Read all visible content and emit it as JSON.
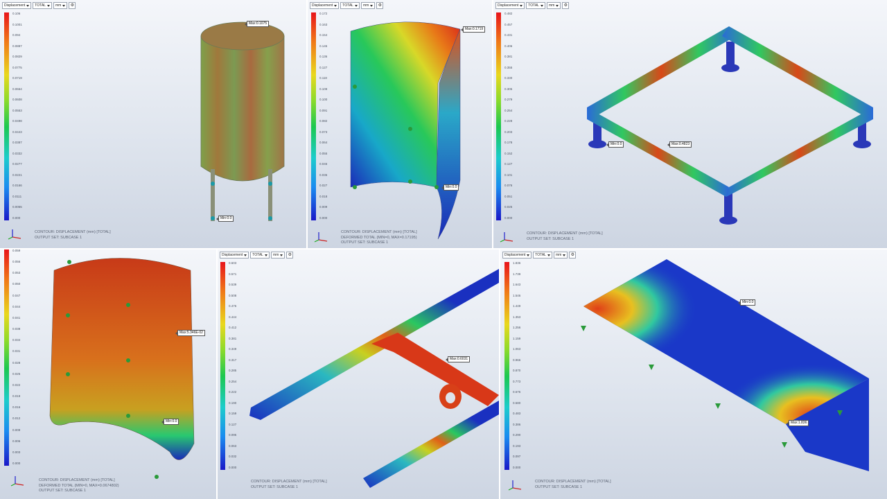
{
  "toolbar": {
    "result_label": "Displacement",
    "component_label": "TOTAL",
    "unit_label": "mm"
  },
  "panels": [
    {
      "ticks": [
        "0.106",
        "0.1001",
        "0.094",
        "0.0887",
        "0.0829",
        "0.0775",
        "0.0719",
        "0.0664",
        "0.0608",
        "0.0553",
        "0.0498",
        "0.0443",
        "0.0387",
        "0.0332",
        "0.0277",
        "0.0221",
        "0.0166",
        "0.0111",
        "0.0055",
        "0.000"
      ],
      "info": [
        "CONTOUR: DISPLACEMENT (mm) [TOTAL]",
        "OUTPUT SET: SUBCASE 1"
      ],
      "tags": [
        "Max:0.1075",
        "Min:0.0"
      ]
    },
    {
      "ticks": [
        "0.172",
        "0.163",
        "0.154",
        "0.145",
        "0.136",
        "0.127",
        "0.118",
        "0.109",
        "0.100",
        "0.091",
        "0.082",
        "0.073",
        "0.064",
        "0.055",
        "0.046",
        "0.036",
        "0.027",
        "0.018",
        "0.009",
        "0.000"
      ],
      "info": [
        "CONTOUR: DISPLACEMENT (mm) [TOTAL]",
        "DEFORMED TOTAL (MIN=0, MAX=0.17195)",
        "OUTPUT SET: SUBCASE 1"
      ],
      "tags": [
        "Max:0.1719",
        "Min:0.0"
      ]
    },
    {
      "ticks": [
        "0.482",
        "0.457",
        "0.431",
        "0.406",
        "0.381",
        "0.355",
        "0.330",
        "0.305",
        "0.279",
        "0.254",
        "0.228",
        "0.203",
        "0.178",
        "0.152",
        "0.127",
        "0.101",
        "0.076",
        "0.051",
        "0.025",
        "0.000"
      ],
      "info": [
        "CONTOUR: DISPLACEMENT (mm) [TOTAL]",
        "OUTPUT SET: SUBCASE 1"
      ],
      "tags": [
        "Max:0.4823",
        "Min:0.0"
      ]
    },
    {
      "ticks": [
        "0.059",
        "0.056",
        "0.053",
        "0.050",
        "0.047",
        "0.044",
        "0.041",
        "0.038",
        "0.034",
        "0.031",
        "0.028",
        "0.025",
        "0.022",
        "0.019",
        "0.016",
        "0.012",
        "0.009",
        "0.006",
        "0.003",
        "0.000"
      ],
      "info": [
        "CONTOUR: DISPLACEMENT (mm) [TOTAL]",
        "DEFORMED TOTAL (MIN=0, MAX=0.0674802)",
        "OUTPUT SET: SUBCASE 1"
      ],
      "tags": [
        "Max:5.346E-02",
        "Min:0.0"
      ]
    },
    {
      "ticks": [
        "0.603",
        "0.571",
        "0.539",
        "0.508",
        "0.476",
        "0.444",
        "0.412",
        "0.381",
        "0.349",
        "0.317",
        "0.285",
        "0.254",
        "0.222",
        "0.190",
        "0.159",
        "0.127",
        "0.095",
        "0.063",
        "0.032",
        "0.000"
      ],
      "info": [
        "CONTOUR: DISPLACEMENT (mm) [TOTAL]",
        "OUTPUT SET: SUBCASE 1"
      ],
      "tags": [
        "Max:0.6031"
      ]
    },
    {
      "ticks": [
        "1.836",
        "1.739",
        "1.643",
        "1.546",
        "1.449",
        "1.353",
        "1.256",
        "1.159",
        "1.063",
        "0.966",
        "0.870",
        "0.773",
        "0.676",
        "0.580",
        "0.483",
        "0.386",
        "0.290",
        "0.193",
        "0.097",
        "0.000"
      ],
      "info": [
        "CONTOUR: DISPLACEMENT (mm) [TOTAL]",
        "OUTPUT SET: SUBCASE 1"
      ],
      "tags": [
        "Min:0.0",
        "Max:1.836"
      ]
    }
  ]
}
